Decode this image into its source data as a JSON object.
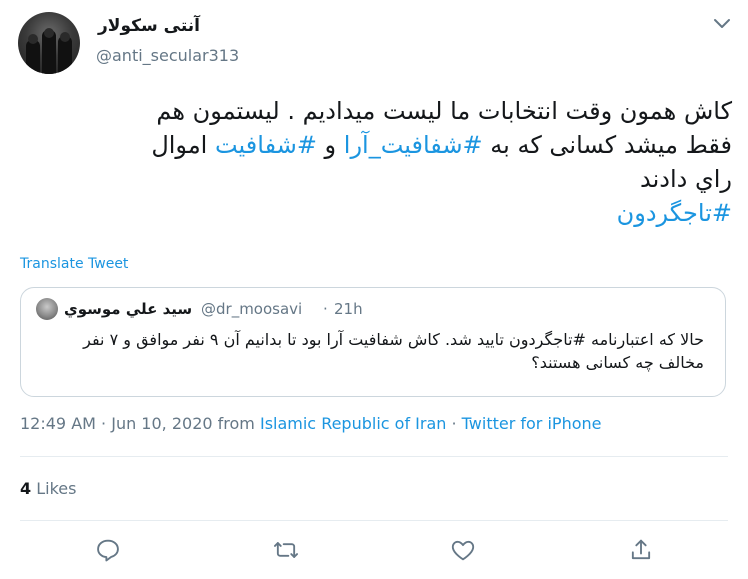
{
  "header": {
    "display_name": "آنتی سکولار",
    "handle": "@anti_secular313"
  },
  "tweet": {
    "line1": "کاش همون وقت انتخابات ما لیست میدادیم . لیستمون هم",
    "line2_part1": "فقط میشد کسانی که به ",
    "line2_hashtag1": "#شفافیت_آرا",
    "line2_part2": " و ",
    "line2_hashtag2": "#شفافیت",
    "line2_part3": " اموال",
    "line3": "راي دادند",
    "line4_hashtag": "#تاجگردون"
  },
  "translate_label": "Translate Tweet",
  "quoted": {
    "name": "سيد علي موسوي",
    "handle": "@dr_moosavi",
    "separator": "·",
    "time": "21h",
    "text": "حالا که اعتبارنامه #تاجگردون تایید شد. کاش شفافیت آرا بود تا بدانیم آن ۹ نفر موافق و ۷ نفر مخالف چه کسانی هستند؟"
  },
  "meta": {
    "time": "12:49 AM",
    "sep1": " · ",
    "date": "Jun 10, 2020",
    "from": " from ",
    "location": "Islamic Republic of Iran",
    "sep2": " · ",
    "source": "Twitter for iPhone"
  },
  "stats": {
    "likes_count": "4",
    "likes_label": "Likes"
  },
  "icons": {
    "caret": "chevron-down-icon",
    "reply": "reply-icon",
    "retweet": "retweet-icon",
    "like": "heart-icon",
    "share": "share-icon"
  },
  "colors": {
    "accent": "#1b95e0",
    "secondary_text": "#657786",
    "border": "#ccd6dd"
  }
}
